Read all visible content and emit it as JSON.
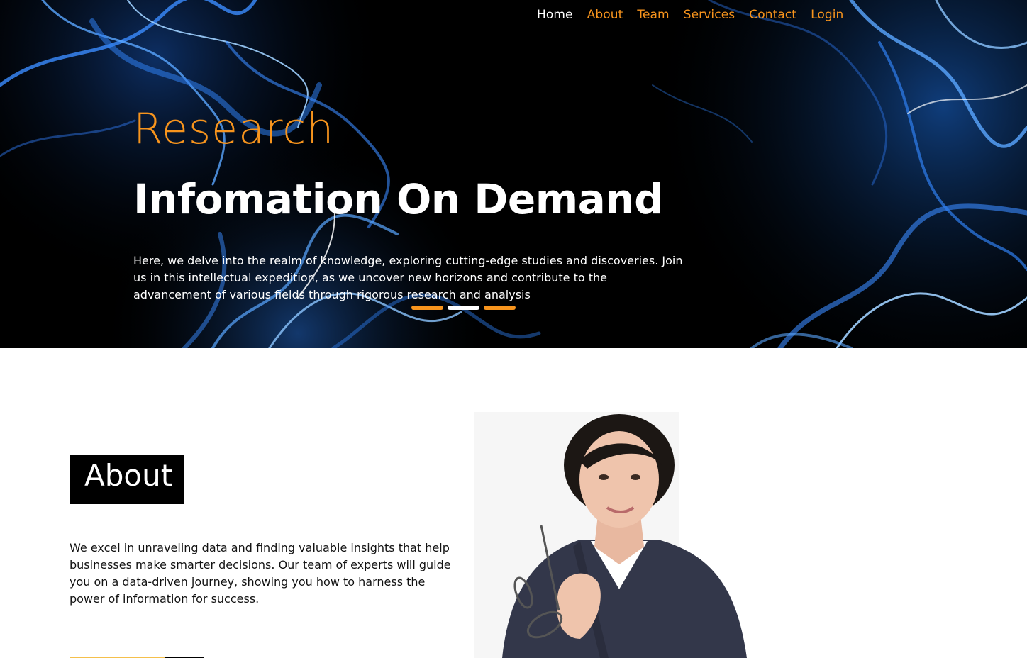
{
  "nav": {
    "items": [
      {
        "label": "Home",
        "active": true
      },
      {
        "label": "About",
        "active": false
      },
      {
        "label": "Team",
        "active": false
      },
      {
        "label": "Services",
        "active": false
      },
      {
        "label": "Contact",
        "active": false
      },
      {
        "label": "Login",
        "active": false
      }
    ]
  },
  "hero": {
    "eyebrow": "Research",
    "title": "Infomation On Demand",
    "text": "Here, we delve into the realm of knowledge, exploring cutting-edge studies and discoveries. Join us in this intellectual expedition, as we uncover new horizons and contribute to the advancement of various fields through rigorous research and analysis",
    "background": "blue-light-strands-image",
    "slides": [
      {
        "active": false
      },
      {
        "active": true
      },
      {
        "active": false
      }
    ]
  },
  "about": {
    "heading": "About",
    "text": "We excel in unraveling data and finding valuable insights that help businesses make smarter decisions. Our team of experts will guide you on a data-driven journey, showing you how to harness the power of information for success.",
    "image": "businesswoman-holding-glasses-photo"
  },
  "colors": {
    "accent": "#f7941d",
    "hero_bg": "#000000",
    "strand_blue": "#2f8bff",
    "button_gold": "#f5c04c",
    "white": "#ffffff"
  }
}
